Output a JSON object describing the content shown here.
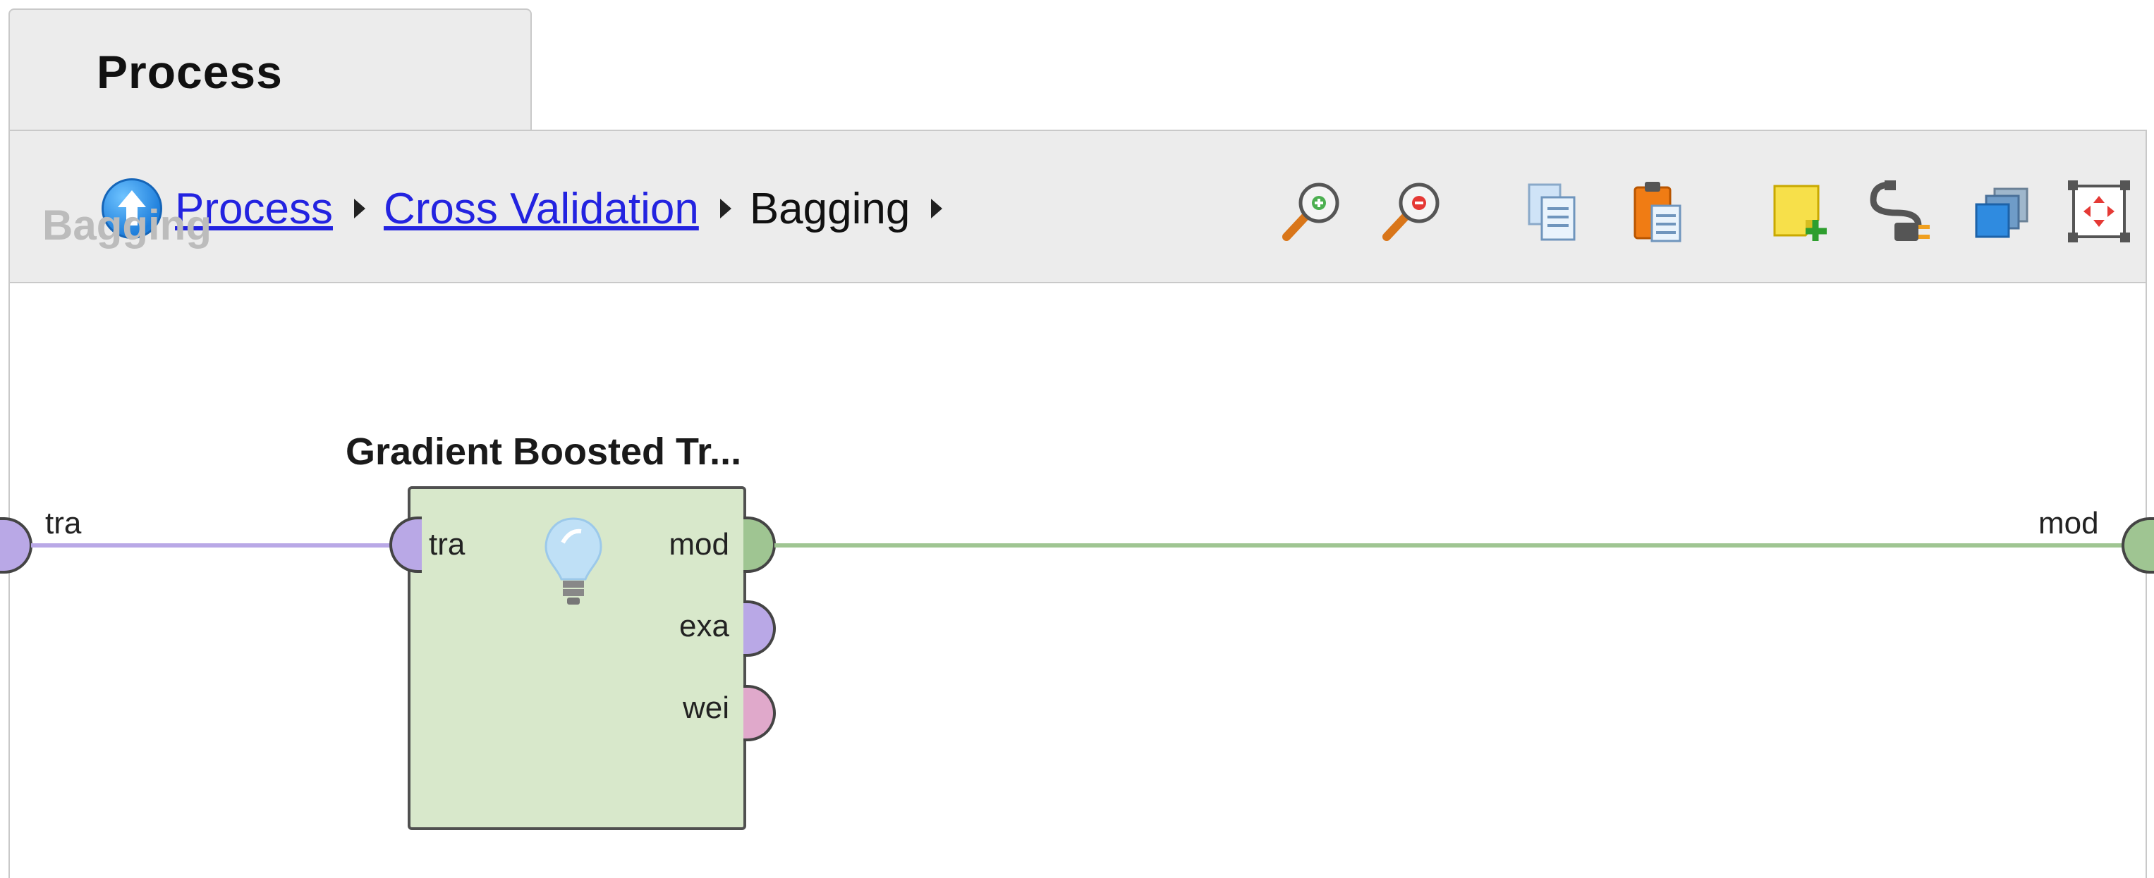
{
  "tab": {
    "label": "Process"
  },
  "breadcrumb": {
    "items": [
      {
        "label": "Process",
        "link": true
      },
      {
        "label": "Cross Validation",
        "link": true
      },
      {
        "label": "Bagging",
        "link": false
      }
    ]
  },
  "toolbar": {
    "icons": [
      "zoom-in-icon",
      "zoom-out-icon",
      "copy-icon",
      "paste-icon",
      "add-note-icon",
      "auto-wire-icon",
      "arrange-layers-icon",
      "fit-to-screen-icon"
    ]
  },
  "canvas": {
    "label": "Bagging",
    "input_port": "tra",
    "output_port": "mod"
  },
  "operator": {
    "title": "Gradient Boosted Tr...",
    "inputs": [
      "tra"
    ],
    "outputs": [
      "mod",
      "exa",
      "wei"
    ],
    "icon": "lightbulb-icon"
  },
  "colors": {
    "link": "#2323e0",
    "operator_fill": "#d8e8cb",
    "port_training": "#b9a8e6",
    "port_model": "#9fc592",
    "port_weights": "#e0a9cb",
    "wire_training": "#b9a8e6",
    "wire_model": "#9fc592"
  }
}
